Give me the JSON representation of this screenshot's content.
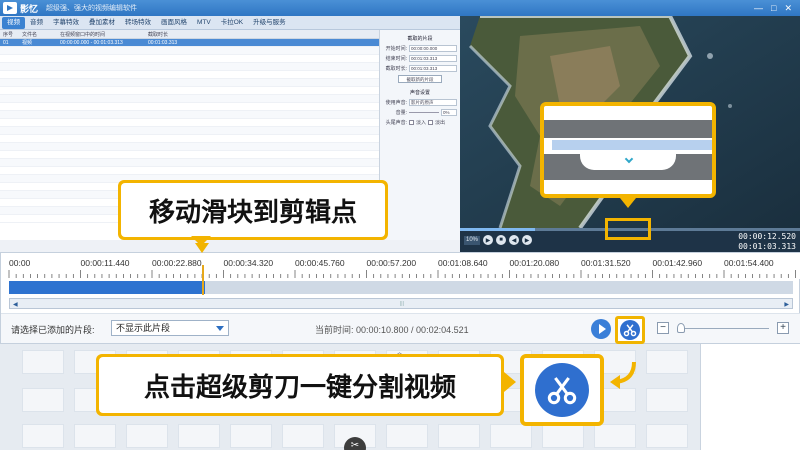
{
  "app": {
    "name": "影忆",
    "subtitle": "超级强、强大的视频编辑软件",
    "window_controls": [
      "—",
      "□",
      "✕"
    ]
  },
  "menu": {
    "tabs": [
      "视频",
      "音频",
      "字幕特效",
      "叠加素材",
      "转场特效",
      "画面风格",
      "MTV",
      "卡拉OK",
      "升级与服务"
    ],
    "active_index": 0
  },
  "list": {
    "headers": [
      "序号",
      "文件名",
      "在视频窗口中的时间",
      "截取时长"
    ],
    "rows": [
      [
        "01",
        "视频",
        "00:00:00.000 - 00:01:03.313",
        "00:01:03.313"
      ]
    ]
  },
  "settings": {
    "crop_section": "截取的片段",
    "start_label": "开始时间:",
    "start_value": "00:00:00.000",
    "end_label": "结束时间:",
    "end_value": "00:01:03.313",
    "duration_label": "截取时长:",
    "duration_value": "00:01:03.313",
    "crop_button": "截取新的片段",
    "audio_section": "声音设置",
    "audio_label": "使用声音:",
    "audio_value": "影片的原声",
    "volume_label": "音量:",
    "volume_value": "0%",
    "fade_label": "头尾声音:",
    "fade_in": "淡入",
    "fade_out": "淡出"
  },
  "player": {
    "zoom": "10%",
    "current_time": "00:00:12.520",
    "total_time": "00:01:03.313",
    "progress": 0.22
  },
  "timeline": {
    "ticks": [
      "00:00",
      "00:00:11.440",
      "00:00:22.880",
      "00:00:34.320",
      "00:00:45.760",
      "00:00:57.200",
      "00:01:08.640",
      "00:01:20.080",
      "00:01:31.520",
      "00:01:42.960",
      "00:01:54.400"
    ],
    "played_fraction": 0.25,
    "select_label": "请选择已添加的片段:",
    "select_value": "不显示此片段",
    "current_time_label": "当前时间: 00:00:10.800 / 00:02:04.521"
  },
  "callouts": {
    "step1": "移动滑块到剪辑点",
    "step2": "点击超级剪刀一键分割视频"
  },
  "colors": {
    "accent": "#f3b400",
    "brand_blue": "#2f6fcf",
    "titlebar": "#2f76c3"
  },
  "icons": {
    "scissors": "scissors-icon",
    "play": "play-icon"
  }
}
